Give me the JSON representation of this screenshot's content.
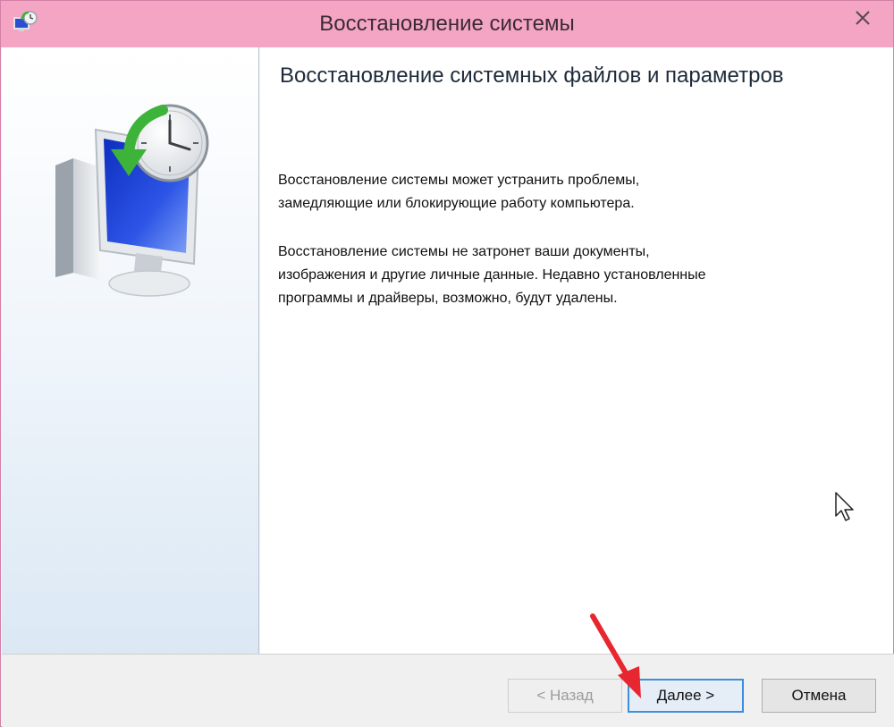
{
  "window": {
    "title": "Восстановление системы",
    "icon": "system-restore-icon",
    "close_icon": "close-icon"
  },
  "sidebar": {
    "graphic": "monitor-clock-restore-icon"
  },
  "content": {
    "heading": "Восстановление системных файлов и параметров",
    "paragraph1_lines": [
      "Восстановление системы может устранить проблемы,",
      "замедляющие или блокирующие работу компьютера."
    ],
    "paragraph2_lines": [
      "Восстановление системы не затронет ваши документы,",
      "изображения и другие личные данные. Недавно установленные",
      "программы и драйверы, возможно, будут удалены."
    ]
  },
  "buttons": {
    "back": "< Назад",
    "next": "Далее >",
    "cancel": "Отмена"
  },
  "annotation": {
    "arrow_color": "#e8262f",
    "arrow_icon": "red-arrow-pointer-icon"
  }
}
